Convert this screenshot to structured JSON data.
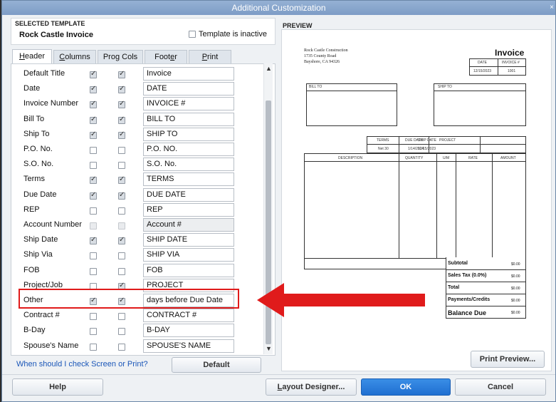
{
  "window": {
    "title": "Additional Customization",
    "close": "×"
  },
  "selected_template": {
    "heading": "SELECTED TEMPLATE",
    "name": "Rock Castle Invoice",
    "inactive_label": "Template is inactive"
  },
  "tabs": [
    {
      "label": "Header",
      "underline": "H",
      "rest": "eader"
    },
    {
      "label": "Columns",
      "underline": "C",
      "rest": "olumns"
    },
    {
      "label": "Prog Cols",
      "pre": "Pro",
      "underline": "g",
      "rest": " Cols"
    },
    {
      "label": "Footer",
      "pre": "Foot",
      "underline": "e",
      "rest": "r"
    },
    {
      "label": "Print",
      "underline": "P",
      "rest": "rint"
    }
  ],
  "fields": [
    {
      "label": "Default Title",
      "screen": true,
      "print": true,
      "title": "Invoice"
    },
    {
      "label": "Date",
      "screen": true,
      "print": true,
      "title": "DATE"
    },
    {
      "label": "Invoice Number",
      "screen": true,
      "print": true,
      "title": "INVOICE #"
    },
    {
      "label": "Bill To",
      "screen": true,
      "print": true,
      "title": "BILL TO"
    },
    {
      "label": "Ship To",
      "screen": true,
      "print": true,
      "title": "SHIP TO"
    },
    {
      "label": "P.O. No.",
      "screen": false,
      "print": false,
      "title": "P.O. NO."
    },
    {
      "label": "S.O. No.",
      "screen": false,
      "print": false,
      "title": "S.O. No."
    },
    {
      "label": "Terms",
      "screen": true,
      "print": true,
      "title": "TERMS"
    },
    {
      "label": "Due Date",
      "screen": true,
      "print": true,
      "title": "DUE DATE"
    },
    {
      "label": "REP",
      "screen": false,
      "print": false,
      "title": "REP"
    },
    {
      "label": "Account Number",
      "screen": false,
      "print": false,
      "title": "Account #",
      "disabled": true
    },
    {
      "label": "Ship Date",
      "screen": true,
      "print": true,
      "title": "SHIP DATE"
    },
    {
      "label": "Ship Via",
      "screen": false,
      "print": false,
      "title": "SHIP VIA"
    },
    {
      "label": "FOB",
      "screen": false,
      "print": false,
      "title": "FOB"
    },
    {
      "label": "Project/Job",
      "screen": false,
      "print": true,
      "title": "PROJECT"
    },
    {
      "label": "Other",
      "screen": true,
      "print": true,
      "title": "days before Due Date"
    },
    {
      "label": "Contract #",
      "screen": false,
      "print": false,
      "title": "CONTRACT #"
    },
    {
      "label": "B-Day",
      "screen": false,
      "print": false,
      "title": "B-DAY"
    },
    {
      "label": "Spouse's Name",
      "screen": false,
      "print": false,
      "title": "SPOUSE'S NAME"
    }
  ],
  "help_link": "When should I check Screen or Print?",
  "buttons": {
    "default": "Default",
    "help": "Help",
    "layout": "Layout Designer...",
    "ok": "OK",
    "cancel": "Cancel",
    "print_preview": "Print Preview..."
  },
  "preview": {
    "heading": "PREVIEW",
    "company": "Rock Castle Construction",
    "address1": "1735 County Road",
    "address2": "Bayshore, CA 94326",
    "doc_title": "Invoice",
    "date_hdr": "DATE",
    "invno_hdr": "INVOICE #",
    "date_val": "12/15/2023",
    "invno_val": "1001",
    "bill_to": "BILL TO",
    "ship_to": "SHIP TO",
    "terms_hdr": "TERMS",
    "terms_val": "Net 30",
    "due_hdr": "DUE DATE",
    "ship_hdr": "SHIP DATE",
    "project_hdr": "PROJECT",
    "due_val": "1/14/2024",
    "ship_val": "12/15/2023",
    "cols": [
      "DESCRIPTION",
      "QUANTITY",
      "U/M",
      "RATE",
      "AMOUNT"
    ],
    "totals": [
      {
        "label": "Subtotal",
        "value": "$0.00"
      },
      {
        "label": "Sales Tax  (0.0%)",
        "value": "$0.00"
      },
      {
        "label": "Total",
        "value": "$0.00"
      },
      {
        "label": "Payments/Credits",
        "value": "$0.00"
      },
      {
        "label": "Balance Due",
        "value": "$0.00"
      }
    ]
  },
  "colors": {
    "highlight": "#e01b1b",
    "ok_button": "#1f6fd1",
    "link": "#1a56b8"
  }
}
